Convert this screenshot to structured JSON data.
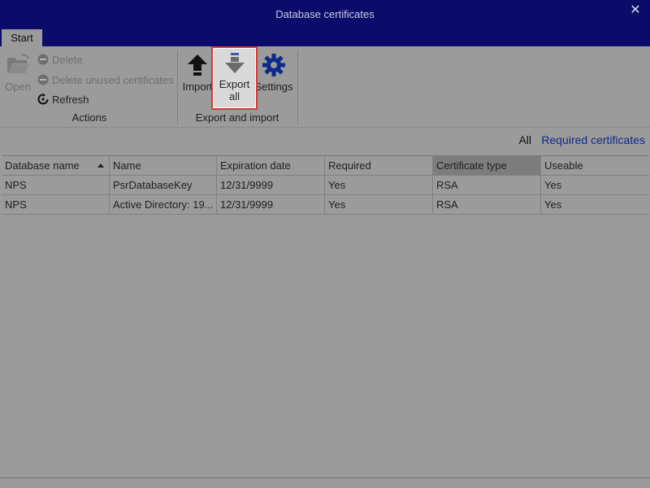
{
  "window": {
    "title": "Database certificates",
    "close_label": "✕"
  },
  "tabs": [
    {
      "label": "Start",
      "active": true
    }
  ],
  "ribbon": {
    "actions": {
      "open_label": "Open",
      "delete_label": "Delete",
      "delete_unused_label": "Delete unused certificates",
      "refresh_label": "Refresh",
      "group_label": "Actions"
    },
    "export_import": {
      "import_label": "Import",
      "export_all_label": "Export all",
      "settings_label": "Settings",
      "group_label": "Export and import"
    }
  },
  "filters": {
    "all_label": "All",
    "required_label": "Required certificates"
  },
  "table": {
    "columns": [
      "Database name",
      "Name",
      "Expiration date",
      "Required",
      "Certificate type",
      "Useable"
    ],
    "sorted_column": "Certificate type",
    "sort_arrow_column": "Database name",
    "rows": [
      [
        "NPS",
        "PsrDatabaseKey",
        "12/31/9999",
        "Yes",
        "RSA",
        "Yes"
      ],
      [
        "NPS",
        "Active Directory: 19...",
        "12/31/9999",
        "Yes",
        "RSA",
        "Yes"
      ]
    ]
  },
  "colors": {
    "titlebar": "#0b0b6a",
    "background": "#9b9b9b",
    "highlight_border": "#d83a3a",
    "link_blue": "#0d2a8a"
  },
  "icons": {
    "open": "folder-open-icon",
    "delete": "minus-circle-icon",
    "refresh": "refresh-icon",
    "import": "arrow-up-icon",
    "export_all": "arrow-down-icon",
    "settings": "gear-icon"
  }
}
